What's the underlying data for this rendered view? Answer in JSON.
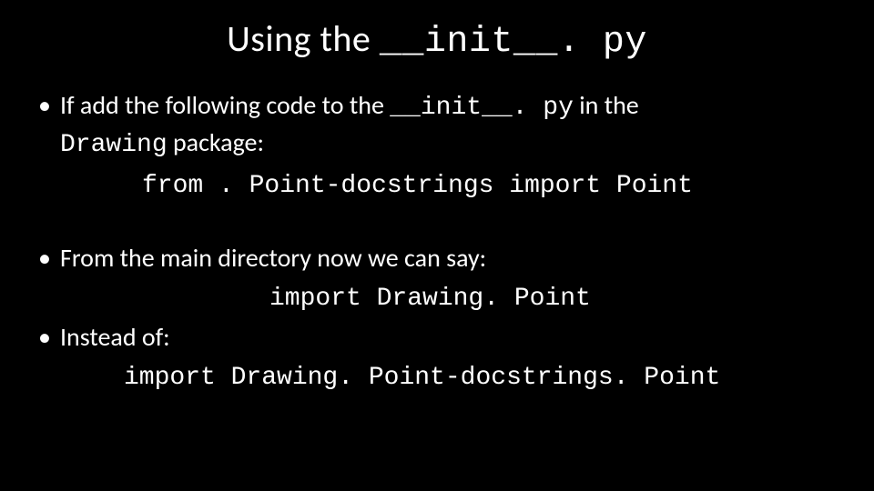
{
  "title": {
    "prefix": "Using the ",
    "code": "__init__. py"
  },
  "bullets": {
    "b1": {
      "t1": "If add the following code to the ",
      "code1": "__init__. py",
      "t2": " in the ",
      "code2": "Drawing",
      "t3": " package:"
    },
    "code_line_1": "from . Point-docstrings import Point",
    "b2": "From the main directory now we can say:",
    "code_line_2": "import Drawing. Point",
    "b3": "Instead of:",
    "code_line_3": "import Drawing. Point-docstrings. Point"
  }
}
